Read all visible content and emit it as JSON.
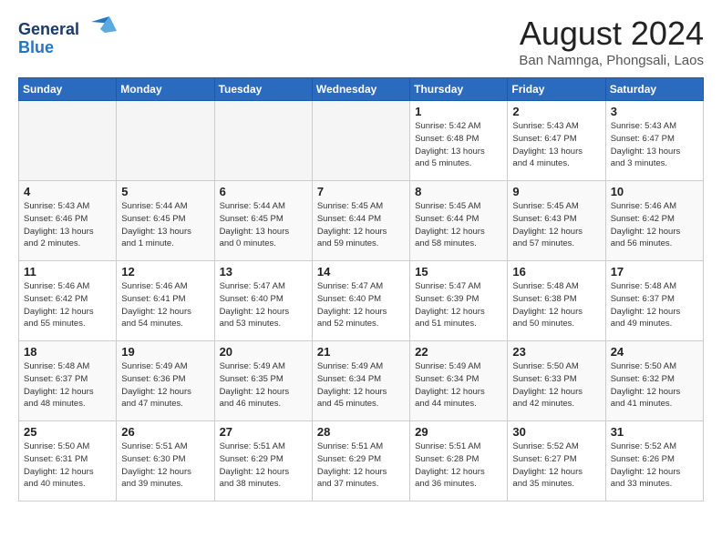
{
  "header": {
    "logo_general": "General",
    "logo_blue": "Blue",
    "month_year": "August 2024",
    "location": "Ban Namnga, Phongsali, Laos"
  },
  "days_of_week": [
    "Sunday",
    "Monday",
    "Tuesday",
    "Wednesday",
    "Thursday",
    "Friday",
    "Saturday"
  ],
  "weeks": [
    [
      {
        "day": "",
        "info": ""
      },
      {
        "day": "",
        "info": ""
      },
      {
        "day": "",
        "info": ""
      },
      {
        "day": "",
        "info": ""
      },
      {
        "day": "1",
        "info": "Sunrise: 5:42 AM\nSunset: 6:48 PM\nDaylight: 13 hours\nand 5 minutes."
      },
      {
        "day": "2",
        "info": "Sunrise: 5:43 AM\nSunset: 6:47 PM\nDaylight: 13 hours\nand 4 minutes."
      },
      {
        "day": "3",
        "info": "Sunrise: 5:43 AM\nSunset: 6:47 PM\nDaylight: 13 hours\nand 3 minutes."
      }
    ],
    [
      {
        "day": "4",
        "info": "Sunrise: 5:43 AM\nSunset: 6:46 PM\nDaylight: 13 hours\nand 2 minutes."
      },
      {
        "day": "5",
        "info": "Sunrise: 5:44 AM\nSunset: 6:45 PM\nDaylight: 13 hours\nand 1 minute."
      },
      {
        "day": "6",
        "info": "Sunrise: 5:44 AM\nSunset: 6:45 PM\nDaylight: 13 hours\nand 0 minutes."
      },
      {
        "day": "7",
        "info": "Sunrise: 5:45 AM\nSunset: 6:44 PM\nDaylight: 12 hours\nand 59 minutes."
      },
      {
        "day": "8",
        "info": "Sunrise: 5:45 AM\nSunset: 6:44 PM\nDaylight: 12 hours\nand 58 minutes."
      },
      {
        "day": "9",
        "info": "Sunrise: 5:45 AM\nSunset: 6:43 PM\nDaylight: 12 hours\nand 57 minutes."
      },
      {
        "day": "10",
        "info": "Sunrise: 5:46 AM\nSunset: 6:42 PM\nDaylight: 12 hours\nand 56 minutes."
      }
    ],
    [
      {
        "day": "11",
        "info": "Sunrise: 5:46 AM\nSunset: 6:42 PM\nDaylight: 12 hours\nand 55 minutes."
      },
      {
        "day": "12",
        "info": "Sunrise: 5:46 AM\nSunset: 6:41 PM\nDaylight: 12 hours\nand 54 minutes."
      },
      {
        "day": "13",
        "info": "Sunrise: 5:47 AM\nSunset: 6:40 PM\nDaylight: 12 hours\nand 53 minutes."
      },
      {
        "day": "14",
        "info": "Sunrise: 5:47 AM\nSunset: 6:40 PM\nDaylight: 12 hours\nand 52 minutes."
      },
      {
        "day": "15",
        "info": "Sunrise: 5:47 AM\nSunset: 6:39 PM\nDaylight: 12 hours\nand 51 minutes."
      },
      {
        "day": "16",
        "info": "Sunrise: 5:48 AM\nSunset: 6:38 PM\nDaylight: 12 hours\nand 50 minutes."
      },
      {
        "day": "17",
        "info": "Sunrise: 5:48 AM\nSunset: 6:37 PM\nDaylight: 12 hours\nand 49 minutes."
      }
    ],
    [
      {
        "day": "18",
        "info": "Sunrise: 5:48 AM\nSunset: 6:37 PM\nDaylight: 12 hours\nand 48 minutes."
      },
      {
        "day": "19",
        "info": "Sunrise: 5:49 AM\nSunset: 6:36 PM\nDaylight: 12 hours\nand 47 minutes."
      },
      {
        "day": "20",
        "info": "Sunrise: 5:49 AM\nSunset: 6:35 PM\nDaylight: 12 hours\nand 46 minutes."
      },
      {
        "day": "21",
        "info": "Sunrise: 5:49 AM\nSunset: 6:34 PM\nDaylight: 12 hours\nand 45 minutes."
      },
      {
        "day": "22",
        "info": "Sunrise: 5:49 AM\nSunset: 6:34 PM\nDaylight: 12 hours\nand 44 minutes."
      },
      {
        "day": "23",
        "info": "Sunrise: 5:50 AM\nSunset: 6:33 PM\nDaylight: 12 hours\nand 42 minutes."
      },
      {
        "day": "24",
        "info": "Sunrise: 5:50 AM\nSunset: 6:32 PM\nDaylight: 12 hours\nand 41 minutes."
      }
    ],
    [
      {
        "day": "25",
        "info": "Sunrise: 5:50 AM\nSunset: 6:31 PM\nDaylight: 12 hours\nand 40 minutes."
      },
      {
        "day": "26",
        "info": "Sunrise: 5:51 AM\nSunset: 6:30 PM\nDaylight: 12 hours\nand 39 minutes."
      },
      {
        "day": "27",
        "info": "Sunrise: 5:51 AM\nSunset: 6:29 PM\nDaylight: 12 hours\nand 38 minutes."
      },
      {
        "day": "28",
        "info": "Sunrise: 5:51 AM\nSunset: 6:29 PM\nDaylight: 12 hours\nand 37 minutes."
      },
      {
        "day": "29",
        "info": "Sunrise: 5:51 AM\nSunset: 6:28 PM\nDaylight: 12 hours\nand 36 minutes."
      },
      {
        "day": "30",
        "info": "Sunrise: 5:52 AM\nSunset: 6:27 PM\nDaylight: 12 hours\nand 35 minutes."
      },
      {
        "day": "31",
        "info": "Sunrise: 5:52 AM\nSunset: 6:26 PM\nDaylight: 12 hours\nand 33 minutes."
      }
    ]
  ]
}
